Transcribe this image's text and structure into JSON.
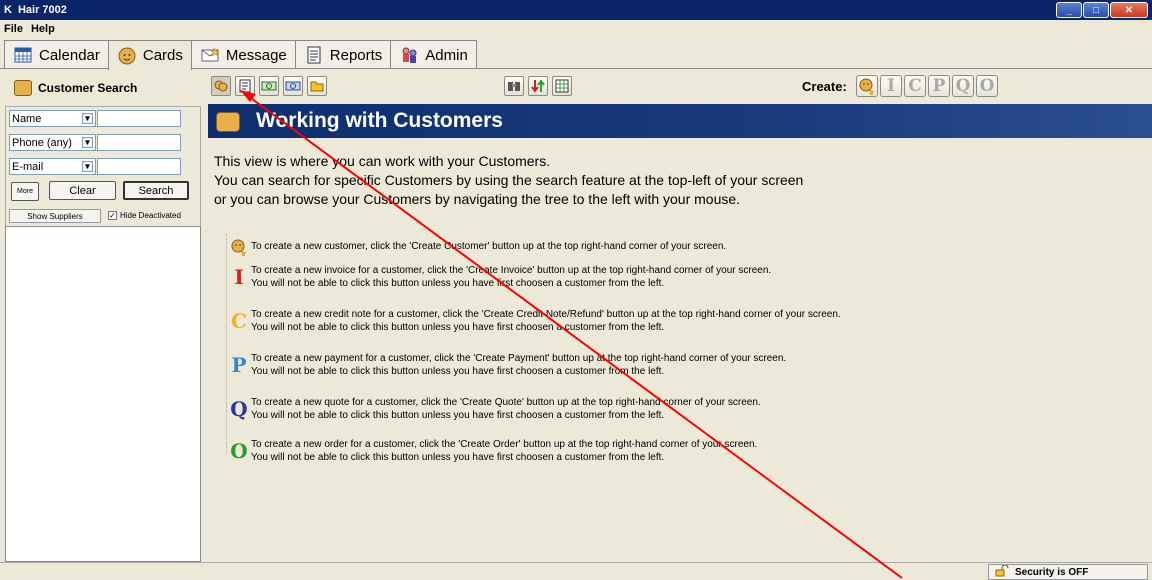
{
  "window": {
    "title": "Hair 7002",
    "app_icon": "K"
  },
  "menu": [
    "File",
    "Help"
  ],
  "tabs": [
    {
      "label": "Calendar",
      "icon": "calendar-icon"
    },
    {
      "label": "Cards",
      "icon": "cards-icon"
    },
    {
      "label": "Message",
      "icon": "message-icon"
    },
    {
      "label": "Reports",
      "icon": "reports-icon"
    },
    {
      "label": "Admin",
      "icon": "admin-icon"
    }
  ],
  "sidebar": {
    "title": "Customer Search",
    "fields": [
      {
        "label": "Name",
        "value": ""
      },
      {
        "label": "Phone (any)",
        "value": ""
      },
      {
        "label": "E-mail",
        "value": ""
      }
    ],
    "more_label": "More",
    "clear_label": "Clear",
    "search_label": "Search",
    "show_suppliers_label": "Show Suppliers",
    "hide_deactivated_label": "Hide Deactivated",
    "hide_deactivated_checked": true
  },
  "toolbar": {
    "create_label": "Create:",
    "create_buttons": [
      "I",
      "C",
      "P",
      "Q",
      "O"
    ]
  },
  "main": {
    "banner_title": "Working with Customers",
    "intro": [
      "This view is where you can work with your Customers.",
      "You can search for specific Customers by using the search feature at the top-left of your screen",
      "or you can browse your Customers by navigating the tree to the left with your mouse."
    ],
    "items": [
      {
        "letter": "",
        "color": "#d4a23a",
        "lines": [
          "To create a new customer, click the 'Create Customer' button up at the top right-hand corner of your screen."
        ]
      },
      {
        "letter": "I",
        "color": "#e02010",
        "lines": [
          "To create a new invoice for a customer, click the 'Create Invoice' button up at the top right-hand corner of your screen.",
          "You will not be able to click this button unless you have first choosen a customer from the left."
        ]
      },
      {
        "letter": "C",
        "color": "#f0b020",
        "lines": [
          "To create a new credit note for a customer, click the 'Create Credit Note/Refund' button up at the top right-hand corner of your screen.",
          "You will not be able to click this button unless you have first choosen a customer from the left."
        ]
      },
      {
        "letter": "P",
        "color": "#2a8ad8",
        "lines": [
          "To create a new payment for a customer, click the 'Create Payment' button up at the top right-hand corner of your screen.",
          "You will not be able to click this button unless you have first choosen a customer from the left."
        ]
      },
      {
        "letter": "Q",
        "color": "#2a3a9a",
        "lines": [
          "To create a new quote for a customer, click the 'Create Quote' button up at the top right-hand corner of your screen.",
          "You will not be able to click this button unless you have first choosen a customer from the left."
        ]
      },
      {
        "letter": "O",
        "color": "#2a9a2a",
        "lines": [
          "To create a new order for a customer, click the 'Create Order' button up at the top right-hand corner of your screen.",
          "You will not be able to click this button unless you have first choosen a customer from the left."
        ]
      }
    ]
  },
  "status": {
    "security": "Security is OFF"
  },
  "colors": {
    "banner": "#0c2e6e",
    "arrow": "#ff0000"
  }
}
